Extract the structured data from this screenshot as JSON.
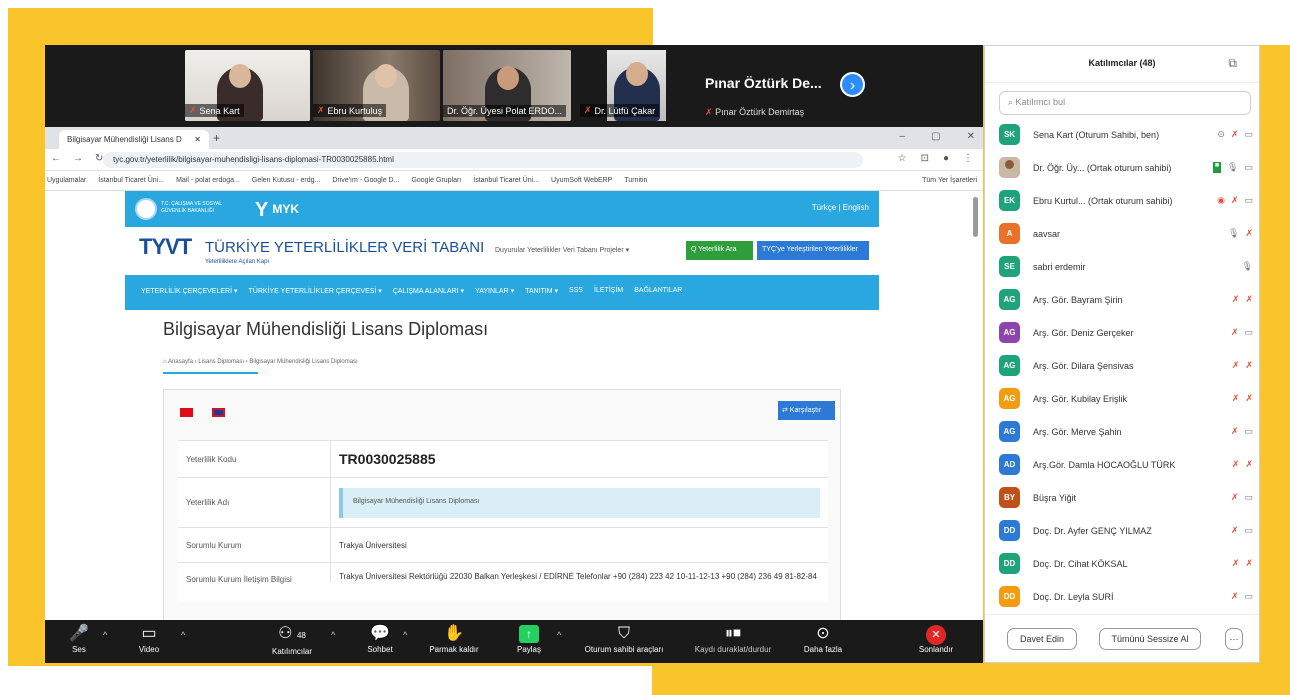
{
  "video_tiles": [
    {
      "name": "Sena Kart"
    },
    {
      "name": "Ebru Kurtuluş"
    },
    {
      "name": "Dr. Öğr. Üyesi Polat ERDO..."
    },
    {
      "name": "Dr. Lütfü Çakar"
    }
  ],
  "featured_name": "Pınar Öztürk De...",
  "featured_sub": "Pınar Öztürk Demirtaş",
  "browser": {
    "tab_title": "Bilgisayar Mühendisliği Lisans D",
    "url": "tyc.gov.tr/yeterlilik/bilgisayar-muhendisligi-lisans-diplomasi-TR0030025885.html",
    "bookmarks": [
      "Uygulamalar",
      "İstanbul Ticaret Üni...",
      "Mail - polat erdoga...",
      "Gelen Kutusu - erdg...",
      "Drive'ım - Google D...",
      "Google Grupları",
      "İstanbul Ticaret Üni...",
      "UyumSoft WebERP",
      "Turnitin"
    ],
    "bookmarks_right": "Tüm Yer İşaretleri"
  },
  "site": {
    "gov_text": "T.C. ÇALIŞMA VE SOSYAL GÜVENLİK BAKANLIĞI",
    "myk": "MYK",
    "lang": "Türkçe | English",
    "logo": "TYVT",
    "title": "TÜRKİYE YETERLİLİKLER VERİ TABANI",
    "subtitle": "Yeterliliklere Açılan Kapı",
    "topnav": "Duyurular   Yeterlilikler Veri Tabanı   Projeler ▾",
    "btn_search": "Q Yeterlilik Ara",
    "btn_tyc": "TYÇ'ye Yerleştirilen Yeterlilikler",
    "menu": [
      "YETERLİLİK ÇERÇEVELERİ ▾",
      "TÜRKİYE YETERLİLİKLER ÇERÇEVESİ ▾",
      "ÇALIŞMA ALANLARI ▾",
      "YAYINLAR ▾",
      "TANITIM ▾",
      "SSS",
      "İLETİŞİM",
      "BAĞLANTILAR"
    ],
    "page_title": "Bilgisayar Mühendisliği Lisans Diploması",
    "breadcrumb": "⌂ Anasayfa  ›  Lisans Diploması  ›  Bilgisayar Mühendisliği Lisans Diploması",
    "compare_btn": "⇄ Karşılaştır",
    "rows": [
      {
        "key": "Yeterlilik Kodu",
        "value": "TR0030025885"
      },
      {
        "key": "Yeterlilik Adı",
        "value": "Bilgisayar Mühendisliği Lisans Diploması"
      },
      {
        "key": "Sorumlu Kurum",
        "value": "Trakya Üniversitesi"
      },
      {
        "key": "Sorumlu Kurum İletişim Bilgisi",
        "value": "Trakya Üniversitesi Rektörlüğü 22030 Balkan Yerleşkesi / EDİRNE Telefonlar +90 (284) 223 42 10-11-12-13 +90 (284) 236 49 81-82-84"
      }
    ]
  },
  "toolbar": {
    "audio": "Ses",
    "video": "Video",
    "participants": "Katılımcılar",
    "participants_count": "48",
    "chat": "Sohbet",
    "raise_hand": "Parmak kaldır",
    "share": "Paylaş",
    "host_tools": "Oturum sahibi araçları",
    "record": "Kaydı duraklat/durdur",
    "more": "Daha fazla",
    "end": "Sonlandır"
  },
  "participants_panel": {
    "title": "Katılımcılar (48)",
    "search_placeholder": "Katılımcı bul",
    "invite": "Davet Edin",
    "mute_all": "Tümünü Sessize Al",
    "more": "···",
    "list": [
      {
        "initials": "SK",
        "name": "Sena Kart (Oturum Sahibi, ben)",
        "color": "#1fa37a"
      },
      {
        "initials": "",
        "name": "Dr. Öğr. Üy... (Ortak oturum sahibi)",
        "color": "#c9b8a6"
      },
      {
        "initials": "EK",
        "name": "Ebru Kurtul... (Ortak oturum sahibi)",
        "color": "#1fa37a"
      },
      {
        "initials": "A",
        "name": "aavsar",
        "color": "#e8712b"
      },
      {
        "initials": "SE",
        "name": "sabri erdemir",
        "color": "#1fa37a"
      },
      {
        "initials": "AG",
        "name": "Arş. Gör. Bayram Şirin",
        "color": "#1fa37a"
      },
      {
        "initials": "AG",
        "name": "Arş. Gör. Deniz Gerçeker",
        "color": "#8e44ad"
      },
      {
        "initials": "AG",
        "name": "Arş. Gör. Dilara Şensivas",
        "color": "#1fa37a"
      },
      {
        "initials": "AG",
        "name": "Arş. Gör. Kubilay Erişlik",
        "color": "#f39c12"
      },
      {
        "initials": "AG",
        "name": "Arş. Gör. Merve Şahin",
        "color": "#2d7ad6"
      },
      {
        "initials": "AD",
        "name": "Arş.Gör. Damla HOCAOĞLU TÜRK",
        "color": "#2d7ad6"
      },
      {
        "initials": "BY",
        "name": "Büşra Yiğit",
        "color": "#c0501a"
      },
      {
        "initials": "DD",
        "name": "Doç. Dr. Ayfer GENÇ YILMAZ",
        "color": "#2d7ad6"
      },
      {
        "initials": "DD",
        "name": "Doç. Dr. Cihat KÖKSAL",
        "color": "#1fa37a"
      },
      {
        "initials": "DD",
        "name": "Doç. Dr. Leyla SURİ",
        "color": "#f39c12"
      }
    ]
  }
}
